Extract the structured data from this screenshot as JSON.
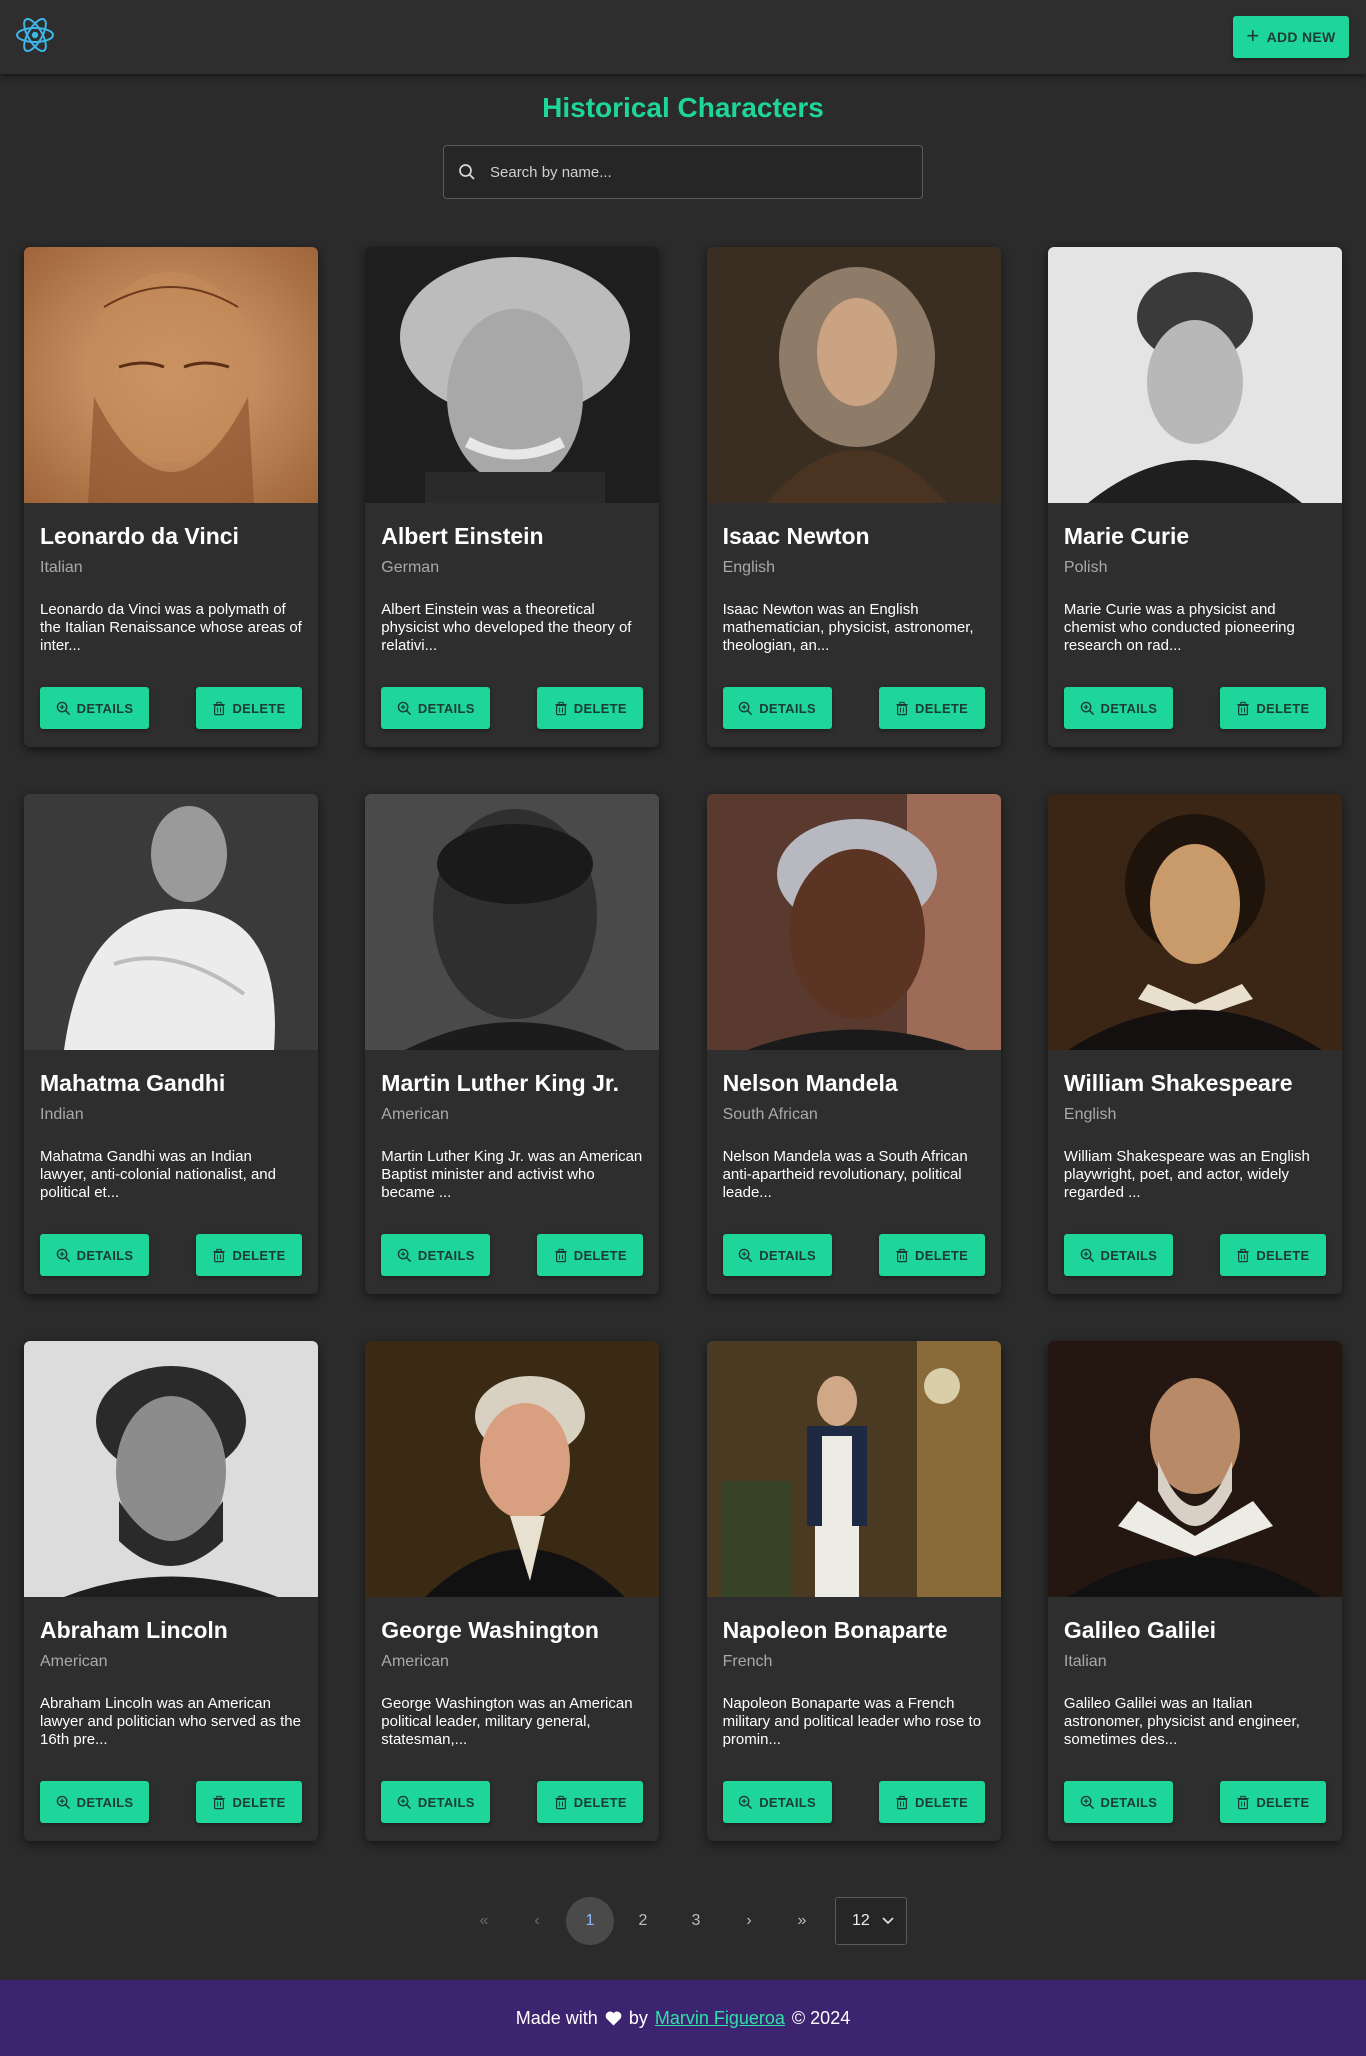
{
  "header": {
    "logo": "react-logo-icon",
    "add_button": {
      "icon": "plus-icon",
      "label": "ADD NEW"
    }
  },
  "page": {
    "title": "Historical Characters",
    "search_placeholder": "Search by name..."
  },
  "cards": [
    {
      "name": "Leonardo da Vinci",
      "nationality": "Italian",
      "bio": "Leonardo da Vinci was a polymath of the Italian Renaissance whose areas of inter...",
      "details_label": "DETAILS",
      "delete_label": "DELETE"
    },
    {
      "name": "Albert Einstein",
      "nationality": "German",
      "bio": "Albert Einstein was a theoretical physicist who developed the theory of relativi...",
      "details_label": "DETAILS",
      "delete_label": "DELETE"
    },
    {
      "name": "Isaac Newton",
      "nationality": "English",
      "bio": "Isaac Newton was an English mathematician, physicist, astronomer, theologian, an...",
      "details_label": "DETAILS",
      "delete_label": "DELETE"
    },
    {
      "name": "Marie Curie",
      "nationality": "Polish",
      "bio": "Marie Curie was a physicist and chemist who conducted pioneering research on rad...",
      "details_label": "DETAILS",
      "delete_label": "DELETE"
    },
    {
      "name": "Mahatma Gandhi",
      "nationality": "Indian",
      "bio": "Mahatma Gandhi was an Indian lawyer, anti-colonial nationalist, and political et...",
      "details_label": "DETAILS",
      "delete_label": "DELETE"
    },
    {
      "name": "Martin Luther King Jr.",
      "nationality": "American",
      "bio": "Martin Luther King Jr. was an American Baptist minister and activist who became ...",
      "details_label": "DETAILS",
      "delete_label": "DELETE"
    },
    {
      "name": "Nelson Mandela",
      "nationality": "South African",
      "bio": "Nelson Mandela was a South African anti-apartheid revolutionary, political leade...",
      "details_label": "DETAILS",
      "delete_label": "DELETE"
    },
    {
      "name": "William Shakespeare",
      "nationality": "English",
      "bio": "William Shakespeare was an English playwright, poet, and actor, widely regarded ...",
      "details_label": "DETAILS",
      "delete_label": "DELETE"
    },
    {
      "name": "Abraham Lincoln",
      "nationality": "American",
      "bio": "Abraham Lincoln was an American lawyer and politician who served as the 16th pre...",
      "details_label": "DETAILS",
      "delete_label": "DELETE"
    },
    {
      "name": "George Washington",
      "nationality": "American",
      "bio": "George Washington was an American political leader, military general, statesman,...",
      "details_label": "DETAILS",
      "delete_label": "DELETE"
    },
    {
      "name": "Napoleon Bonaparte",
      "nationality": "French",
      "bio": "Napoleon Bonaparte was a French military and political leader who rose to promin...",
      "details_label": "DETAILS",
      "delete_label": "DELETE"
    },
    {
      "name": "Galileo Galilei",
      "nationality": "Italian",
      "bio": "Galileo Galilei was an Italian astronomer, physicist and engineer, sometimes des...",
      "details_label": "DETAILS",
      "delete_label": "DELETE"
    }
  ],
  "pagination": {
    "first": "«",
    "prev": "‹",
    "pages": [
      "1",
      "2",
      "3"
    ],
    "current": "1",
    "next": "›",
    "last": "»",
    "per_page": "12"
  },
  "footer": {
    "made_with": "Made with",
    "heart_icon": "heart-icon",
    "by": "by",
    "author": "Marvin Figueroa",
    "copyright": "© 2024"
  },
  "colors": {
    "accent": "#1fd69a",
    "background": "#2b2b2b",
    "card": "#2e2e2e",
    "footer": "#3d2470"
  }
}
